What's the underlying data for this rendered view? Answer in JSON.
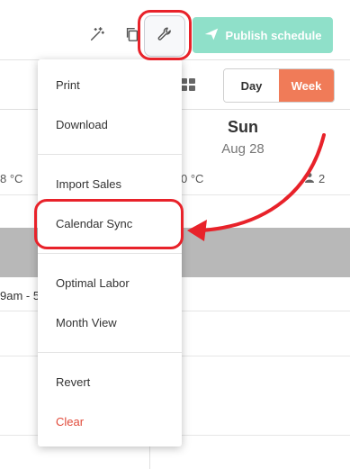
{
  "toolbar": {
    "icons": [
      "magic-wand-icon",
      "copy-icon",
      "wrench-icon"
    ],
    "publish_label": "Publish schedule",
    "publish_color": "#8fe0c9"
  },
  "view_toggle": {
    "day_label": "Day",
    "week_label": "Week",
    "active": "Week",
    "active_color": "#f07b58"
  },
  "calendar": {
    "day_name": "Sun",
    "day_date": "Aug 28",
    "temp_left": "8 °C",
    "temp_right": "0 °C",
    "staff_count": "2",
    "shift_text": "9am - 5"
  },
  "menu": {
    "items": [
      "Print",
      "Download",
      "Import Sales",
      "Calendar Sync",
      "Optimal Labor",
      "Month View",
      "Revert",
      "Clear"
    ],
    "danger_color": "#e14b3b"
  },
  "annotation_color": "#e8222a"
}
